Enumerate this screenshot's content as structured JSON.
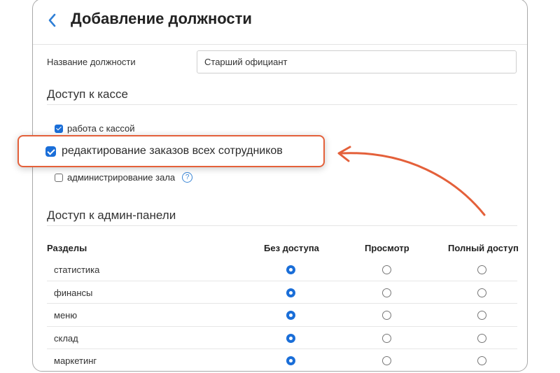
{
  "header": {
    "back_icon": "chevron-left-icon",
    "title": "Добавление должности"
  },
  "position_name": {
    "label": "Название должности",
    "value": "Старший официант"
  },
  "cash_access": {
    "title": "Доступ к кассе",
    "options": [
      {
        "label": "работа с кассой",
        "checked": true
      },
      {
        "label": "редактирование заказов всех сотрудников",
        "checked": true,
        "highlighted": true
      },
      {
        "label": "администрирование зала",
        "checked": false,
        "help_icon": "?"
      }
    ]
  },
  "admin_access": {
    "title": "Доступ к админ-панели",
    "columns": [
      "Разделы",
      "Без доступа",
      "Просмотр",
      "Полный доступ"
    ],
    "rows": [
      {
        "name": "статистика",
        "selected": "Без доступа"
      },
      {
        "name": "финансы",
        "selected": "Без доступа"
      },
      {
        "name": "меню",
        "selected": "Без доступа"
      },
      {
        "name": "склад",
        "selected": "Без доступа"
      },
      {
        "name": "маркетинг",
        "selected": "Без доступа"
      }
    ]
  },
  "colors": {
    "accent": "#1a6ed8",
    "annotation": "#e4603a"
  }
}
